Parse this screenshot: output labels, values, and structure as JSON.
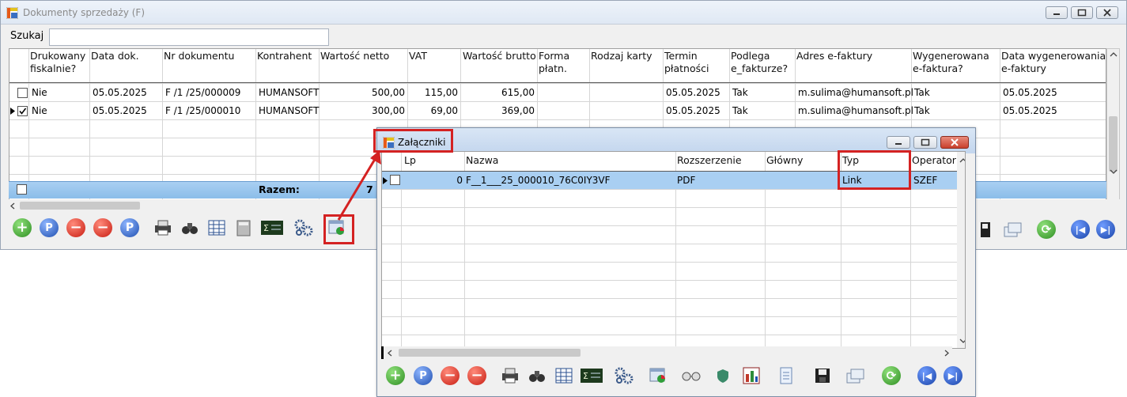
{
  "main_window": {
    "title": "Dokumenty sprzedaży (F)",
    "search_label": "Szukaj",
    "search_value": "",
    "columns": [
      "Drukowany fiskalnie?",
      "Data dok.",
      "Nr dokumentu",
      "Kontrahent",
      "Wartość netto",
      "VAT",
      "Wartość brutto",
      "Forma płatn.",
      "Rodzaj karty",
      "Termin płatności",
      "Podlega e_fakturze?",
      "Adres e-faktury",
      "Wygenerowana e-faktura?",
      "Data wygenerowania e-faktury"
    ],
    "rows": [
      {
        "checked": false,
        "current": false,
        "fiskalny": "Nie",
        "data": "05.05.2025",
        "nr": "F /1  /25/000009",
        "kontrahent": "HUMANSOFT",
        "netto": "500,00",
        "vat": "115,00",
        "brutto": "615,00",
        "forma": "",
        "karta": "",
        "termin": "05.05.2025",
        "podlega": "Tak",
        "adres": "m.sulima@humansoft.pl",
        "wygenerowana": "Tak",
        "data_gen": "05.05.2025"
      },
      {
        "checked": true,
        "current": true,
        "fiskalny": "Nie",
        "data": "05.05.2025",
        "nr": "F /1  /25/000010",
        "kontrahent": "HUMANSOFT",
        "netto": "300,00",
        "vat": "69,00",
        "brutto": "369,00",
        "forma": "",
        "karta": "",
        "termin": "05.05.2025",
        "podlega": "Tak",
        "adres": "m.sulima@humansoft.pl",
        "wygenerowana": "Tak",
        "data_gen": "05.05.2025"
      }
    ],
    "summary_label": "Razem:",
    "summary_value": "7"
  },
  "attachments_dialog": {
    "title": "Załączniki",
    "columns": [
      "Lp",
      "Nazwa",
      "Rozszerzenie",
      "Główny",
      "Typ",
      "Operator"
    ],
    "rows": [
      {
        "lp": "0",
        "nazwa": "F__1___25_000010_76C0IY3VF",
        "rozszerzenie": "PDF",
        "glowny": "",
        "typ": "Link",
        "operator": "SZEF"
      }
    ]
  },
  "colors": {
    "highlight": "#d42222",
    "selected_row": "#a9cff2",
    "summary_row": "#8bbde9"
  }
}
